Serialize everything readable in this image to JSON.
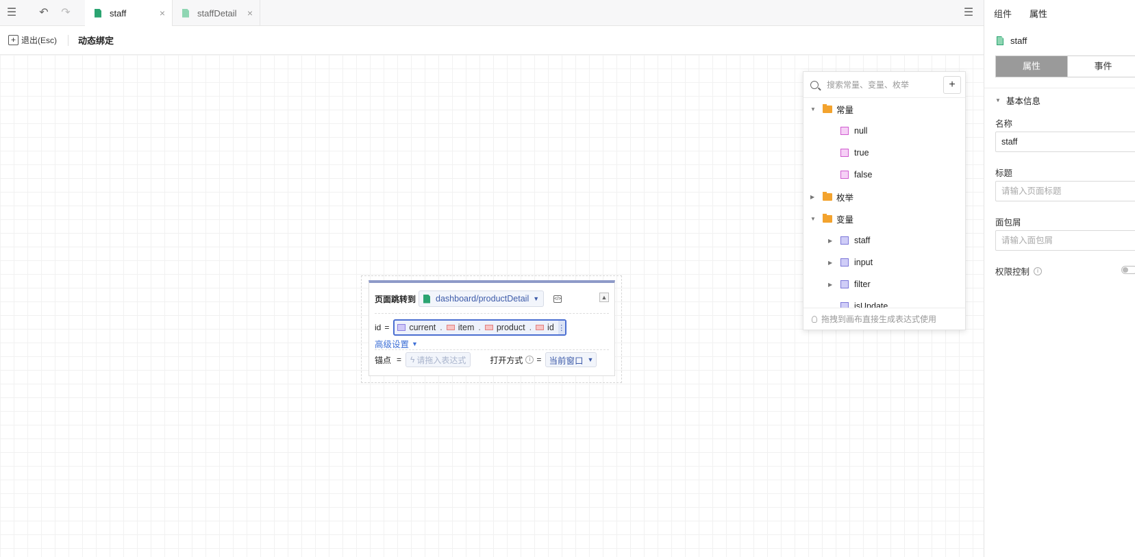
{
  "tabs": [
    {
      "label": "staff",
      "active": true
    },
    {
      "label": "staffDetail",
      "active": false
    }
  ],
  "toolbar": {
    "exit_label": "退出(Esc)",
    "title": "动态绑定"
  },
  "node": {
    "title": "页面跳转到",
    "target": "dashboard/productDetail",
    "param_name": "id",
    "equals": "=",
    "expr_parts": [
      "current",
      "item",
      "product",
      "id"
    ],
    "dot": ".",
    "advanced_label": "高级设置",
    "anchor_label": "锚点",
    "anchor_placeholder": "请拖入表达式",
    "open_mode_label": "打开方式",
    "open_mode_value": "当前窗口"
  },
  "popup": {
    "search_placeholder": "搜索常量、变量、枚举",
    "add_symbol": "+",
    "tree": [
      {
        "type": "folder",
        "label": "常量",
        "expanded": true
      },
      {
        "type": "const",
        "label": "null"
      },
      {
        "type": "const",
        "label": "true"
      },
      {
        "type": "const",
        "label": "false"
      },
      {
        "type": "folder",
        "label": "枚举",
        "expanded": false
      },
      {
        "type": "folder",
        "label": "变量",
        "expanded": true
      },
      {
        "type": "var",
        "label": "staff"
      },
      {
        "type": "var",
        "label": "input"
      },
      {
        "type": "var",
        "label": "filter"
      },
      {
        "type": "var",
        "label": "isUpdate"
      }
    ],
    "footer": "拖拽到画布直接生成表达式使用"
  },
  "right_panel": {
    "tabs": [
      "组件",
      "属性"
    ],
    "file_name": "staff",
    "seg": [
      "属性",
      "事件"
    ],
    "section": "基本信息",
    "name_label": "名称",
    "name_value": "staff",
    "title_label": "标题",
    "title_placeholder": "请输入页面标题",
    "crumb_label": "面包屑",
    "crumb_placeholder": "请输入面包屑",
    "perm_label": "权限控制"
  }
}
